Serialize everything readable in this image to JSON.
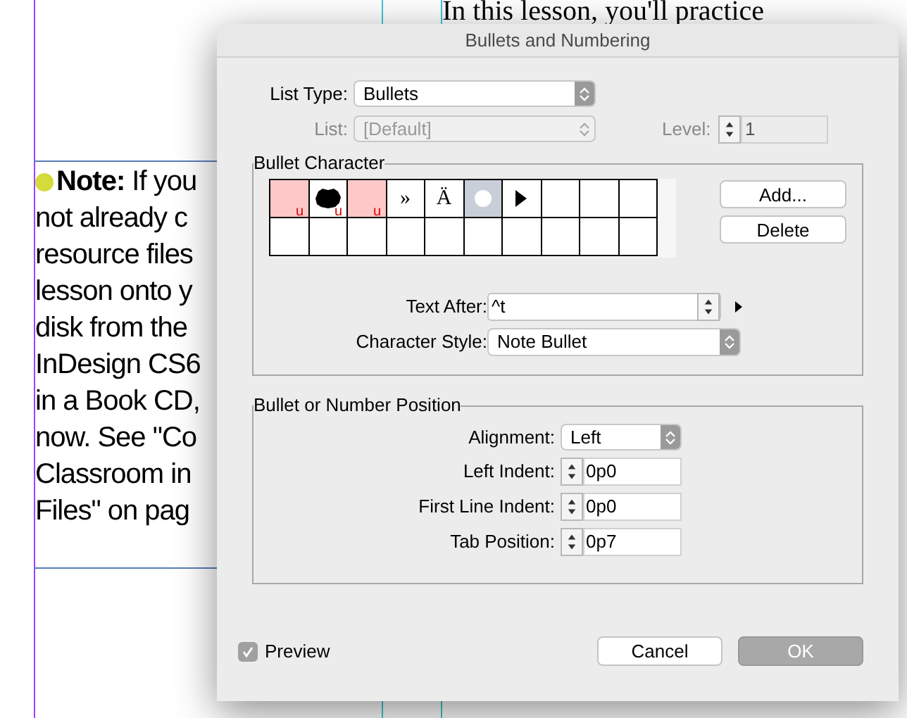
{
  "page": {
    "heading": "In this lesson, you'll practice",
    "note": {
      "bullet": {
        "color": "#d4dc3c"
      },
      "lines": [
        "**Note:** If you",
        "not already c",
        "resource files",
        "lesson onto y",
        "disk from the",
        "InDesign CS6",
        "in a Book CD,",
        "now. See \"Co",
        "Classroom in",
        "Files\" on pag"
      ]
    }
  },
  "dialog": {
    "title": "Bullets and Numbering",
    "list_type": {
      "label": "List Type:",
      "value": "Bullets"
    },
    "list": {
      "label": "List:",
      "value": "[Default]",
      "disabled": true
    },
    "level": {
      "label": "Level:",
      "value": "1",
      "disabled": true
    },
    "bullet_character": {
      "legend": "Bullet Character",
      "cells": [
        {
          "kind": "missing",
          "mark": "u",
          "selected": false
        },
        {
          "kind": "blob",
          "mark": "u",
          "selected": false
        },
        {
          "kind": "missing",
          "mark": "u",
          "selected": false
        },
        {
          "kind": "char",
          "char": "»",
          "selected": false
        },
        {
          "kind": "char",
          "char": "Ä",
          "selected": false
        },
        {
          "kind": "circle",
          "selected": true
        },
        {
          "kind": "triangle",
          "selected": false
        },
        {
          "kind": "empty",
          "selected": false
        },
        {
          "kind": "empty",
          "selected": false
        },
        {
          "kind": "empty",
          "selected": false
        },
        {
          "kind": "empty",
          "selected": false
        },
        {
          "kind": "empty",
          "selected": false
        },
        {
          "kind": "empty",
          "selected": false
        },
        {
          "kind": "empty",
          "selected": false
        },
        {
          "kind": "empty",
          "selected": false
        },
        {
          "kind": "empty",
          "selected": false
        },
        {
          "kind": "empty",
          "selected": false
        },
        {
          "kind": "empty",
          "selected": false
        },
        {
          "kind": "empty",
          "selected": false
        },
        {
          "kind": "empty",
          "selected": false
        }
      ],
      "buttons": [
        "Add...",
        "Delete"
      ],
      "text_after": {
        "label": "Text After:",
        "value": "^t"
      },
      "character_style": {
        "label": "Character Style:",
        "value": "Note Bullet"
      }
    },
    "position": {
      "legend": "Bullet or Number Position",
      "alignment": {
        "label": "Alignment:",
        "value": "Left"
      },
      "fields": [
        {
          "label": "Left Indent:",
          "value": "0p0"
        },
        {
          "label": "First Line Indent:",
          "value": "0p0"
        },
        {
          "label": "Tab Position:",
          "value": "0p7"
        }
      ]
    },
    "preview": {
      "label": "Preview",
      "checked": true
    },
    "buttons": [
      {
        "label": "Cancel",
        "default": false
      },
      {
        "label": "OK",
        "default": true
      }
    ]
  }
}
